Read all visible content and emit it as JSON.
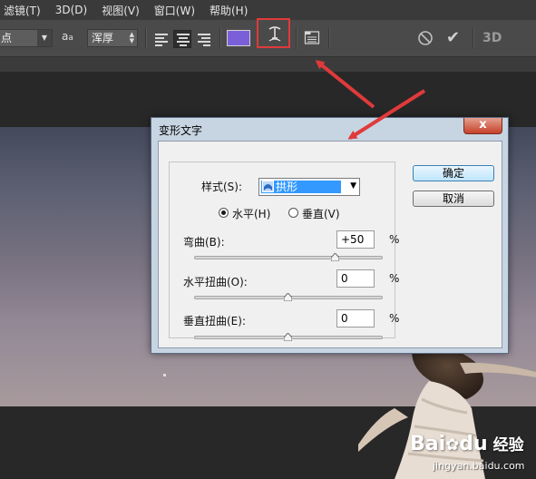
{
  "menu": [
    "滤镜(T)",
    "3D(D)",
    "视图(V)",
    "窗口(W)",
    "帮助(H)"
  ],
  "options_bar": {
    "unit_value": "点",
    "antialias_icon_label": "a",
    "antialias_icon_small": "a",
    "antialias_value": "浑厚",
    "text_color": "#7b5fd9",
    "threed_label": "3D"
  },
  "dialog": {
    "title": "变形文字",
    "close_label": "x",
    "style_label": "样式(S):",
    "style_value": "拱形",
    "horizontal_label": "水平(H)",
    "vertical_label": "垂直(V)",
    "orientation_selected": "horizontal",
    "bend_label": "弯曲(B):",
    "bend_value": "+50",
    "bend_fraction": 0.75,
    "h_distortion_label": "水平扭曲(O):",
    "h_distortion_value": "0",
    "h_distortion_fraction": 0.5,
    "v_distortion_label": "垂直扭曲(E):",
    "v_distortion_value": "0",
    "v_distortion_fraction": 0.5,
    "percent": "%",
    "ok_label": "确定",
    "cancel_label": "取消"
  },
  "watermark": {
    "brand": "Bai",
    "brand_suffix": "du",
    "product": "经验",
    "url": "jingyan.baidu.com"
  },
  "colors": {
    "highlight": "#e03a3a",
    "swatch": "#7b5fd9"
  }
}
